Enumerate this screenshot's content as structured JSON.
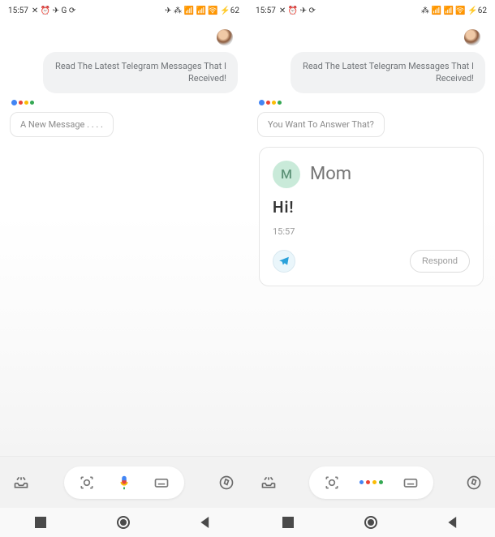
{
  "left": {
    "status": {
      "time": "15:57",
      "icons_left": "✕ ⏰ ✈ G ⟳",
      "icons_right": "✈ ⁂ 📶 📶 🛜 ⚡62"
    },
    "user_message": "Read The Latest Telegram Messages That I Received!",
    "assistant_reply": "A New Message . . . ."
  },
  "right": {
    "status": {
      "time": "15:57",
      "icons_left": "✕ ⏰ ✈ ⟳",
      "icons_right": "⁂ 📶 📶 🛜 ⚡62"
    },
    "user_message": "Read The Latest Telegram Messages That I Received!",
    "assistant_reply": "You Want To Answer That?",
    "card": {
      "avatar_initial": "M",
      "name": "Mom",
      "body": "Hi!",
      "time": "15:57",
      "respond_label": "Respond"
    }
  }
}
